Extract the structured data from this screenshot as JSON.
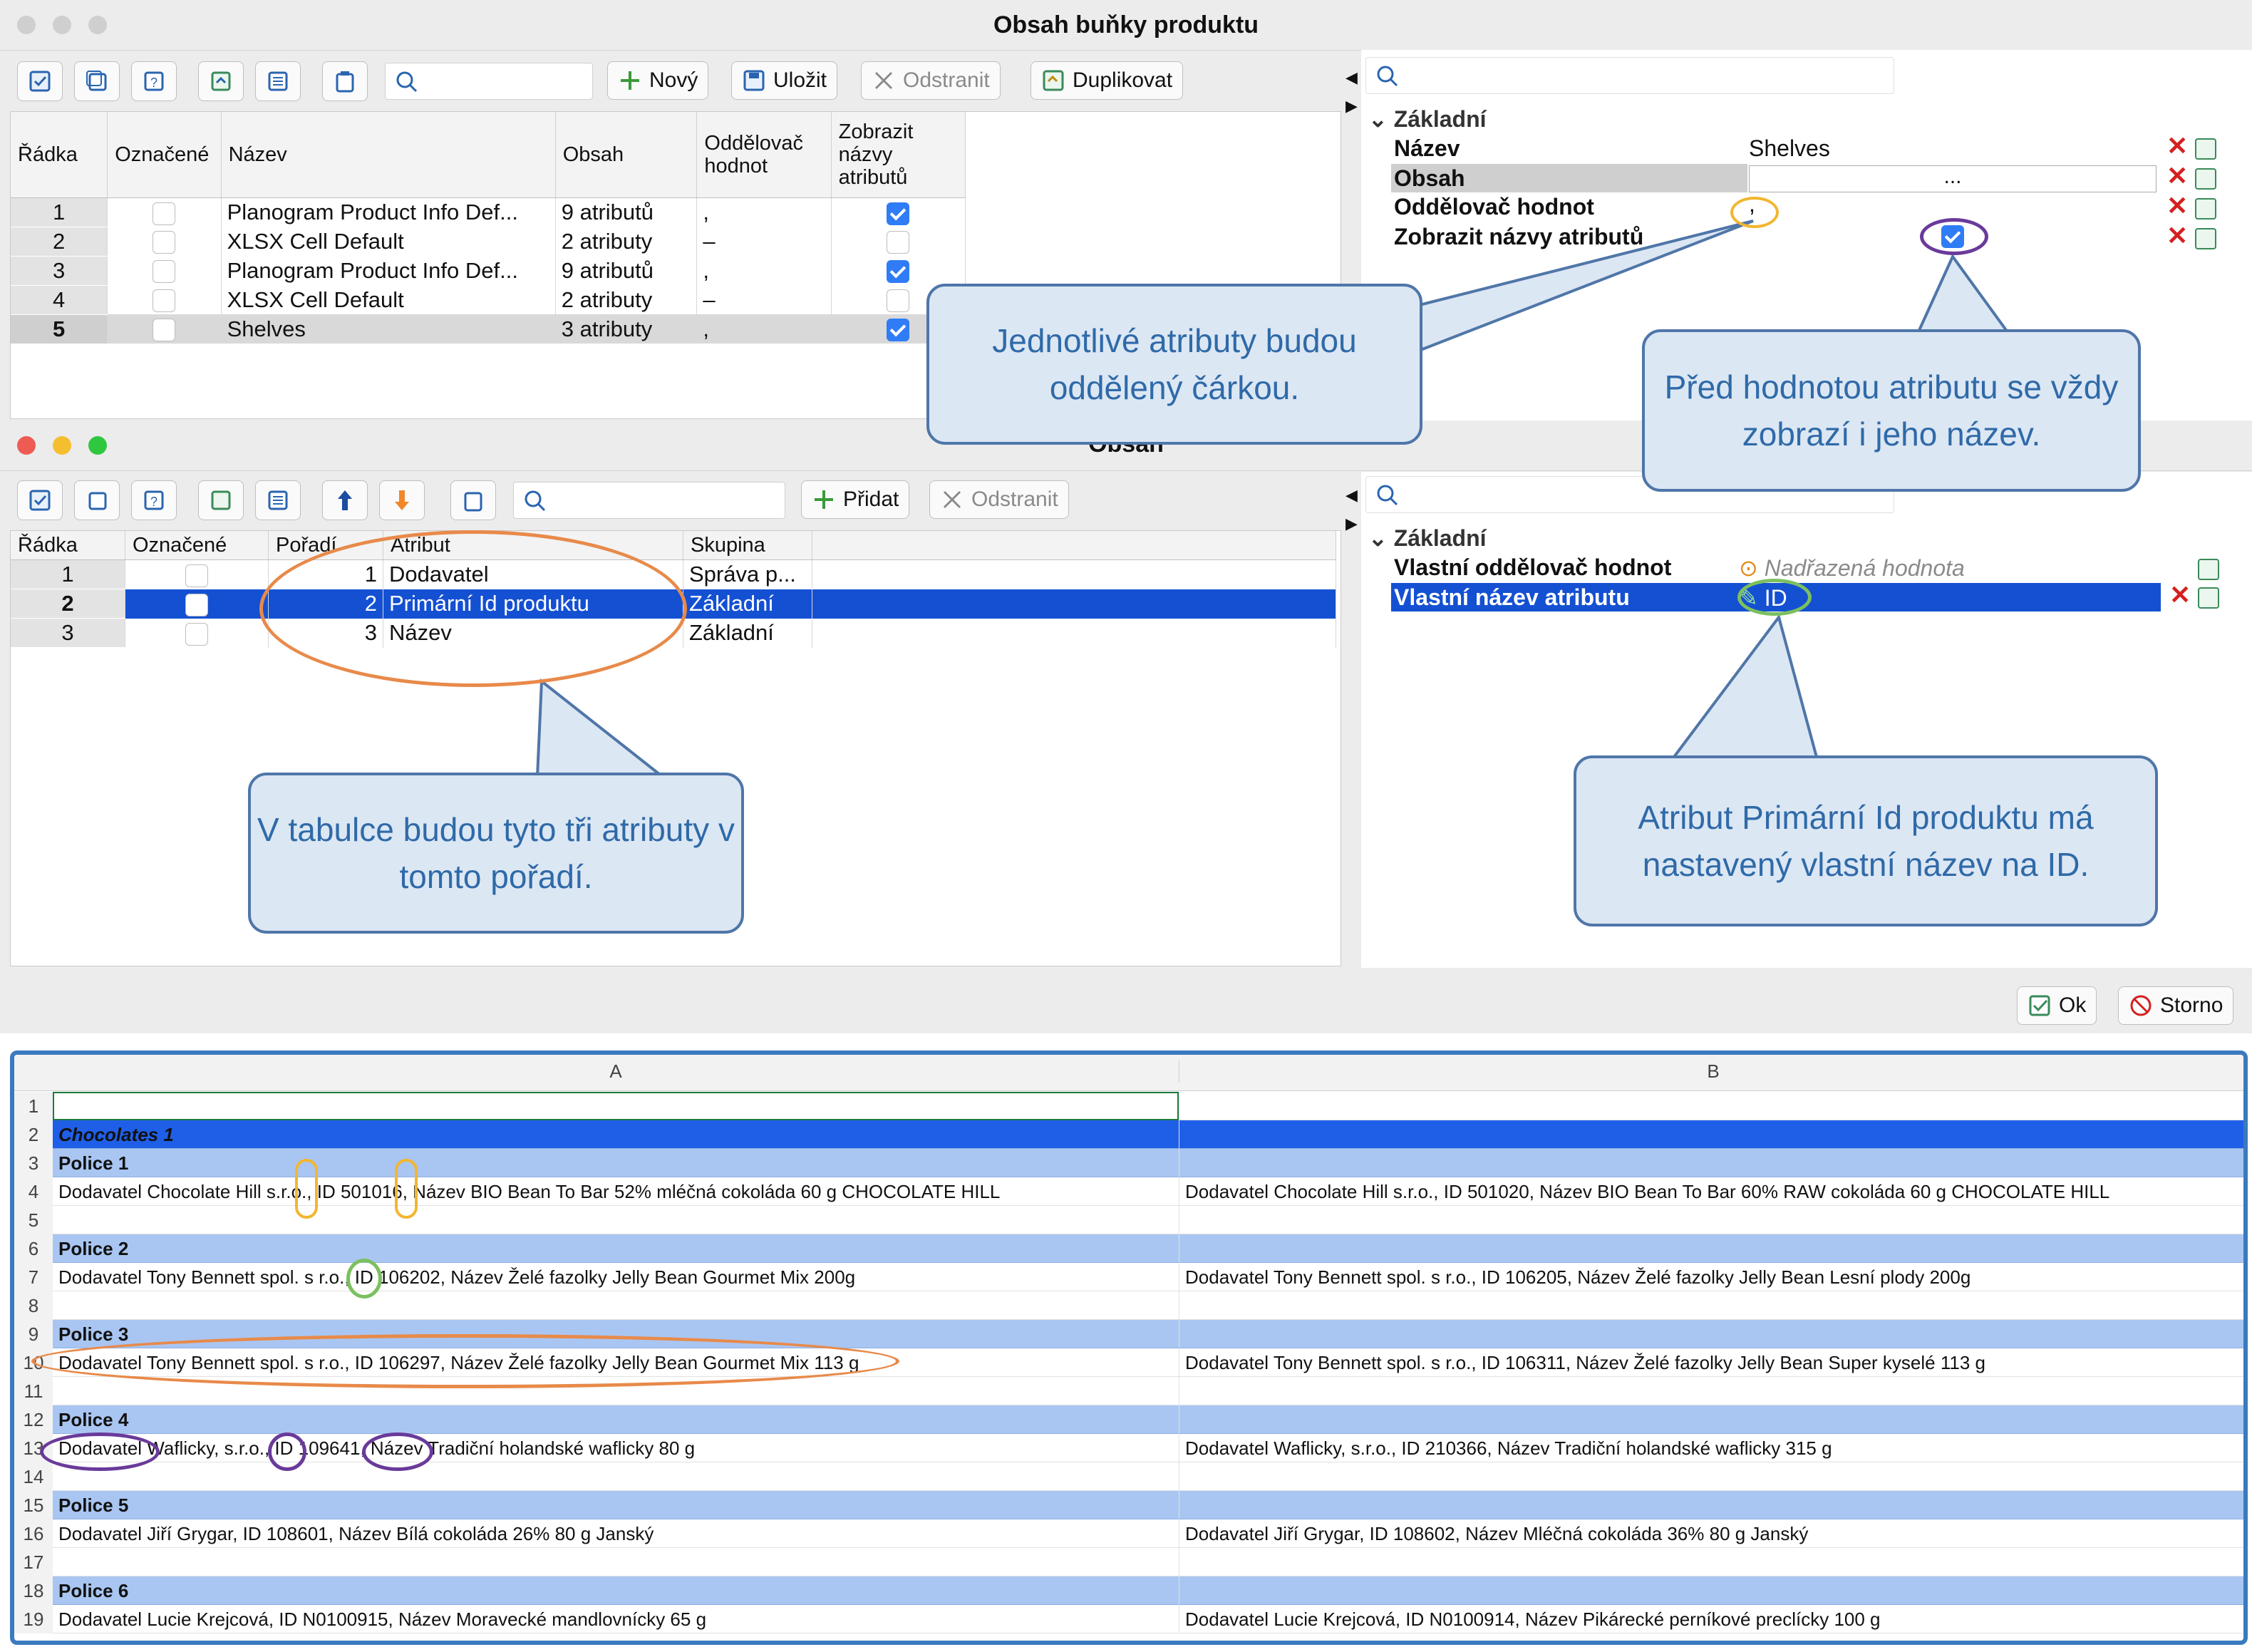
{
  "main_window": {
    "title": "Obsah buňky produktu",
    "toolbar": {
      "new_label": "Nový",
      "save_label": "Uložit",
      "delete_label": "Odstranit",
      "duplicate_label": "Duplikovat"
    },
    "table": {
      "headers": [
        "Řádka",
        "Označené",
        "Název",
        "Obsah",
        "Oddělovač hodnot",
        "Zobrazit názvy atributů"
      ],
      "rows": [
        {
          "n": "1",
          "name": "Planogram Product Info Def...",
          "content": "9 atributů",
          "sep": ",",
          "show": true
        },
        {
          "n": "2",
          "name": "XLSX Cell Default",
          "content": "2 atributy",
          "sep": "–",
          "show": false
        },
        {
          "n": "3",
          "name": "Planogram Product Info Def...",
          "content": "9 atributů",
          "sep": ",",
          "show": true
        },
        {
          "n": "4",
          "name": "XLSX Cell Default",
          "content": "2 atributy",
          "sep": "–",
          "show": false
        },
        {
          "n": "5",
          "name": "Shelves",
          "content": "3 atributy",
          "sep": ",",
          "show": true
        }
      ]
    },
    "props": {
      "section": "Základní",
      "name_label": "Název",
      "name_value": "Shelves",
      "content_label": "Obsah",
      "content_value": "...",
      "sep_label": "Oddělovač hodnot",
      "sep_value": ",",
      "show_label": "Zobrazit názvy atributů"
    }
  },
  "sub_window": {
    "title": "Obsah",
    "toolbar": {
      "add_label": "Přidat",
      "delete_label": "Odstranit"
    },
    "table": {
      "headers": [
        "Řádka",
        "Označené",
        "Pořadí",
        "Atribut",
        "Skupina"
      ],
      "rows": [
        {
          "n": "1",
          "order": "1",
          "attr": "Dodavatel",
          "group": "Správa p..."
        },
        {
          "n": "2",
          "order": "2",
          "attr": "Primární Id produktu",
          "group": "Základní"
        },
        {
          "n": "3",
          "order": "3",
          "attr": "Název",
          "group": "Základní"
        }
      ]
    },
    "props": {
      "section": "Základní",
      "sep_label": "Vlastní oddělovač hodnot",
      "sep_value": "Nadřazená hodnota",
      "name_label": "Vlastní název atributu",
      "name_value": "ID"
    }
  },
  "dialog_buttons": {
    "ok_label": "Ok",
    "cancel_label": "Storno"
  },
  "callouts": {
    "separator": "Jednotlivé atributy budou oddělený čárkou.",
    "show_names": "Před hodnotou atributu se vždy zobrazí i jeho název.",
    "order": "V tabulce budou tyto tři atributy v tomto pořadí.",
    "custom_name": "Atribut Primární Id produktu má nastavený vlastní název na ID."
  },
  "spreadsheet": {
    "col_a": "A",
    "col_b": "B",
    "rows": [
      {
        "n": "1",
        "a": "",
        "b": "",
        "style": "plain"
      },
      {
        "n": "2",
        "a": "Chocolates 1",
        "b": "",
        "style": "group"
      },
      {
        "n": "3",
        "a": "Police 1",
        "b": "",
        "style": "shelf"
      },
      {
        "n": "4",
        "a": "Dodavatel Chocolate Hill s.r.o., ID 501016, Název BIO Bean To Bar 52% mléčná cokoláda 60 g CHOCOLATE HILL",
        "b": "Dodavatel Chocolate Hill s.r.o., ID 501020, Název BIO Bean To Bar 60% RAW cokoláda 60 g CHOCOLATE HILL",
        "style": "plain"
      },
      {
        "n": "5",
        "a": "",
        "b": "",
        "style": "plain"
      },
      {
        "n": "6",
        "a": "Police 2",
        "b": "",
        "style": "shelf"
      },
      {
        "n": "7",
        "a": "Dodavatel Tony Bennett spol. s r.o., ID 106202, Název Želé fazolky Jelly Bean Gourmet Mix 200g",
        "b": "Dodavatel Tony Bennett spol. s r.o., ID 106205, Název Želé fazolky Jelly Bean Lesní plody 200g",
        "style": "plain"
      },
      {
        "n": "8",
        "a": "",
        "b": "",
        "style": "plain"
      },
      {
        "n": "9",
        "a": "Police 3",
        "b": "",
        "style": "shelf"
      },
      {
        "n": "10",
        "a": "Dodavatel Tony Bennett spol. s r.o., ID 106297, Název Želé fazolky Jelly Bean Gourmet Mix 113 g",
        "b": "Dodavatel Tony Bennett spol. s r.o., ID 106311, Název Želé fazolky Jelly Bean Super kyselé 113 g",
        "style": "plain"
      },
      {
        "n": "11",
        "a": "",
        "b": "",
        "style": "plain"
      },
      {
        "n": "12",
        "a": "Police 4",
        "b": "",
        "style": "shelf"
      },
      {
        "n": "13",
        "a": "Dodavatel Waflicky, s.r.o., ID 109641, Název Tradiční holandské waflicky 80 g",
        "b": "Dodavatel Waflicky, s.r.o., ID 210366, Název Tradiční holandské waflicky 315 g",
        "style": "plain"
      },
      {
        "n": "14",
        "a": "",
        "b": "",
        "style": "plain"
      },
      {
        "n": "15",
        "a": "Police 5",
        "b": "",
        "style": "shelf"
      },
      {
        "n": "16",
        "a": "Dodavatel Jiří Grygar, ID 108601, Název Bílá cokoláda 26% 80 g Janský",
        "b": "Dodavatel Jiří Grygar, ID 108602, Název Mléčná cokoláda 36% 80 g Janský",
        "style": "plain"
      },
      {
        "n": "17",
        "a": "",
        "b": "",
        "style": "plain"
      },
      {
        "n": "18",
        "a": "Police 6",
        "b": "",
        "style": "shelf"
      },
      {
        "n": "19",
        "a": "Dodavatel Lucie Krejcová, ID N0100915, Název Moravecké mandlovnícky 65 g",
        "b": "Dodavatel Lucie Krejcová, ID N0100914, Název Pikárecké perníkové preclícky 100 g",
        "style": "plain"
      }
    ]
  }
}
